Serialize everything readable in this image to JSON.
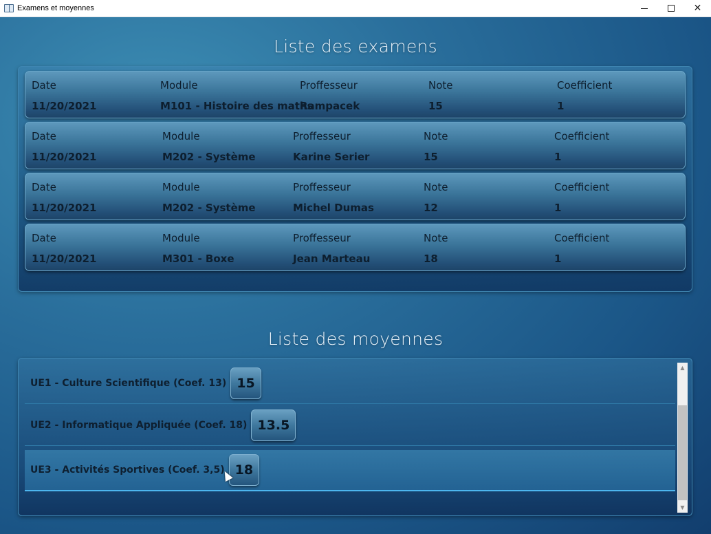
{
  "window": {
    "title": "Examens et moyennes",
    "icon": "book-icon",
    "controls": {
      "minimize": "minimize-icon",
      "maximize": "maximize-icon",
      "close": "✕"
    }
  },
  "exams": {
    "title": "Liste des examens",
    "labels": {
      "date": "Date",
      "module": "Module",
      "professor": "Proffesseur",
      "grade": "Note",
      "coefficient": "Coefficient"
    },
    "items": [
      {
        "date": "11/20/2021",
        "module": "M101 - Histoire des maths",
        "professor": "Rampacek",
        "grade": "15",
        "coefficient": "1"
      },
      {
        "date": "11/20/2021",
        "module": "M202 - Système",
        "professor": "Karine Serier",
        "grade": "15",
        "coefficient": "1"
      },
      {
        "date": "11/20/2021",
        "module": "M202 - Système",
        "professor": "Michel Dumas",
        "grade": "12",
        "coefficient": "1"
      },
      {
        "date": "11/20/2021",
        "module": "M301 - Boxe",
        "professor": "Jean Marteau",
        "grade": "18",
        "coefficient": "1"
      }
    ]
  },
  "averages": {
    "title": "Liste des moyennes",
    "items": [
      {
        "label": "UE1 - Culture Scientifique (Coef. 13)",
        "value": "15"
      },
      {
        "label": "UE2 - Informatique Appliquée (Coef. 18)",
        "value": "13.5"
      },
      {
        "label": "UE3 - Activités Sportives (Coef. 3,5)",
        "value": "18",
        "selected": true
      }
    ]
  },
  "colors": {
    "accent": "#4db6ef",
    "text_dark": "#0d1e2e",
    "background": "#1b5687"
  }
}
